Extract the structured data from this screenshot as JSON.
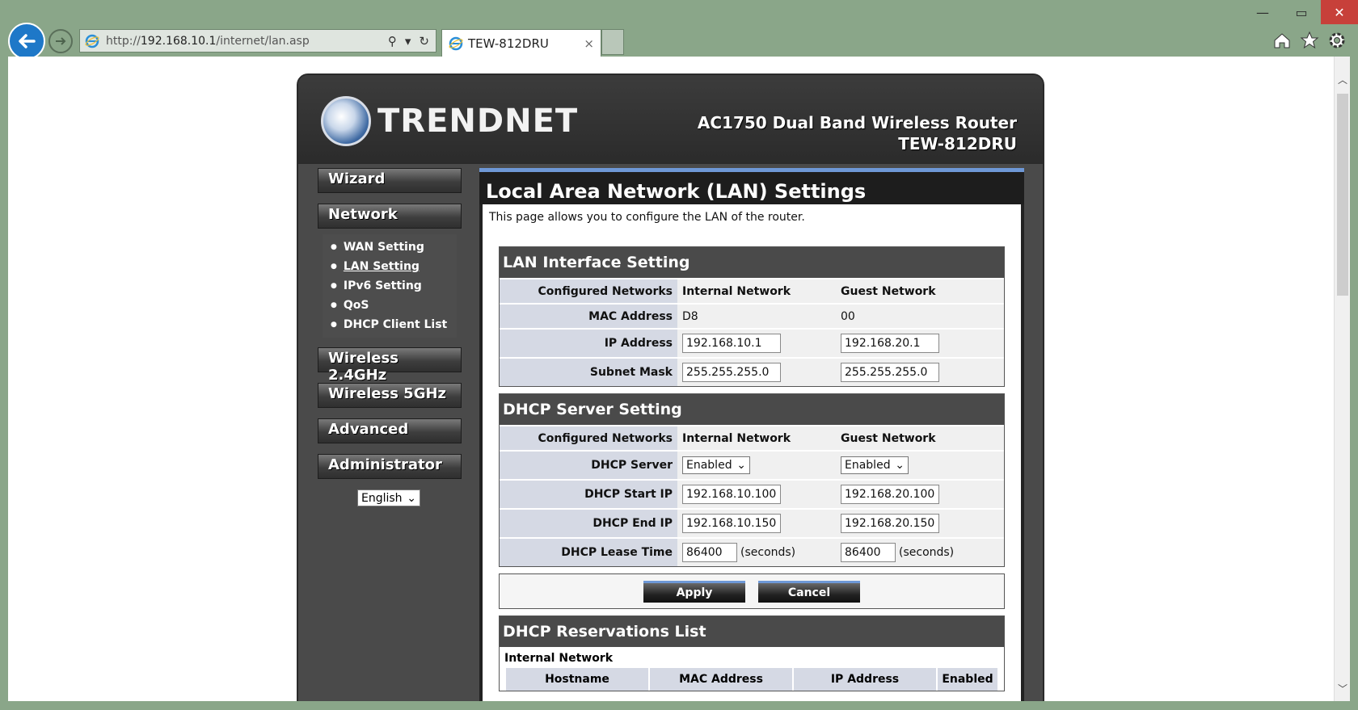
{
  "browser": {
    "url_prefix": "http://",
    "url_host": "192.168.10.1",
    "url_path": "/internet/lan.asp",
    "tab_title": "TEW-812DRU",
    "tab_close": "×"
  },
  "header": {
    "logo_text": "TRENDNET",
    "model_line1": "AC1750 Dual Band Wireless Router",
    "model_line2": "TEW-812DRU"
  },
  "menu": {
    "wizard": "Wizard",
    "network": "Network",
    "network_items": [
      "WAN Setting",
      "LAN Setting",
      "IPv6 Setting",
      "QoS",
      "DHCP Client List"
    ],
    "wireless24": "Wireless 2.4GHz",
    "wireless5": "Wireless 5GHz",
    "advanced": "Advanced",
    "administrator": "Administrator",
    "language": "English"
  },
  "page": {
    "title": "Local Area Network (LAN) Settings",
    "intro": "This page allows you to configure the LAN of the router."
  },
  "lan": {
    "title": "LAN Interface Setting",
    "configured_networks": "Configured Networks",
    "internal": "Internal Network",
    "guest": "Guest Network",
    "mac_label": "MAC Address",
    "mac_internal": "D8",
    "mac_guest": "00",
    "ip_label": "IP Address",
    "ip_internal": "192.168.10.1",
    "ip_guest": "192.168.20.1",
    "mask_label": "Subnet Mask",
    "mask_internal": "255.255.255.0",
    "mask_guest": "255.255.255.0"
  },
  "dhcp": {
    "title": "DHCP Server Setting",
    "configured_networks": "Configured Networks",
    "internal": "Internal Network",
    "guest": "Guest Network",
    "server_label": "DHCP Server",
    "server_internal": "Enabled",
    "server_guest": "Enabled",
    "start_label": "DHCP Start IP",
    "start_internal": "192.168.10.100",
    "start_guest": "192.168.20.100",
    "end_label": "DHCP End IP",
    "end_internal": "192.168.10.150",
    "end_guest": "192.168.20.150",
    "lease_label": "DHCP Lease Time",
    "lease_internal": "86400",
    "lease_guest": "86400",
    "seconds": "(seconds)"
  },
  "buttons": {
    "apply": "Apply",
    "cancel": "Cancel"
  },
  "reservations": {
    "title": "DHCP Reservations List",
    "sub": "Internal Network",
    "columns": [
      "Hostname",
      "MAC Address",
      "IP Address",
      "Enabled"
    ]
  }
}
